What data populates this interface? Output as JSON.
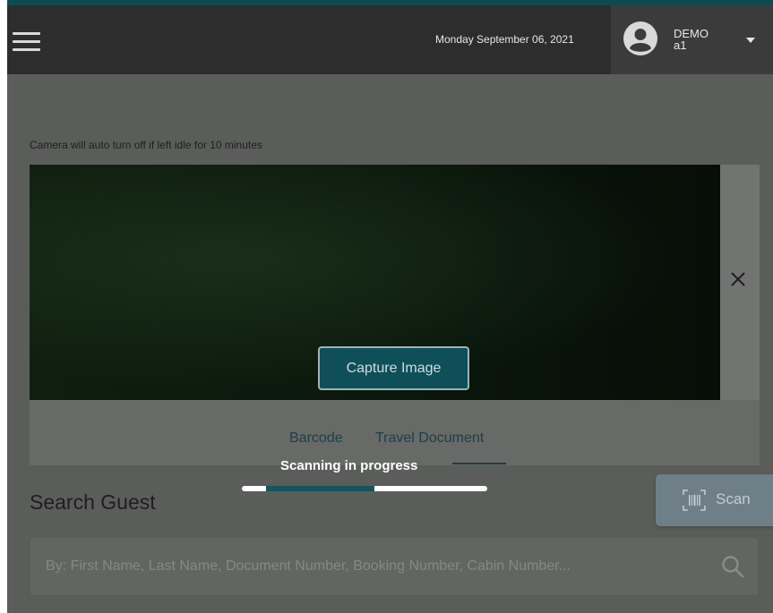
{
  "header": {
    "date": "Monday September 06, 2021",
    "user_line1": "DEMO",
    "user_line2": "a1",
    "icons": {
      "menu": "hamburger-icon",
      "avatar": "user-avatar-icon",
      "dropdown": "caret-down-icon"
    }
  },
  "camera": {
    "hint": "Camera will auto turn off if left idle for 10 minutes",
    "capture_label": "Capture Image",
    "close_icon": "close-icon"
  },
  "tabs": [
    {
      "label": "Barcode",
      "active": false
    },
    {
      "label": "Travel Document",
      "active": true
    }
  ],
  "scanning": {
    "status": "Scanning in progress",
    "progress_start": 0.1,
    "progress_end": 0.54
  },
  "search": {
    "title": "Search Guest",
    "placeholder": "By: First Name, Last Name, Document Number, Booking Number, Cabin Number...",
    "value": "",
    "icon": "search-icon"
  },
  "scan_button": {
    "label": "Scan",
    "icon": "barcode-scan-icon"
  },
  "colors": {
    "accent": "#0f4f5a",
    "header_bg": "#2d2d2d",
    "overlay_bg": "#5b5d5b",
    "scan_button_bg": "#6f7f87"
  }
}
